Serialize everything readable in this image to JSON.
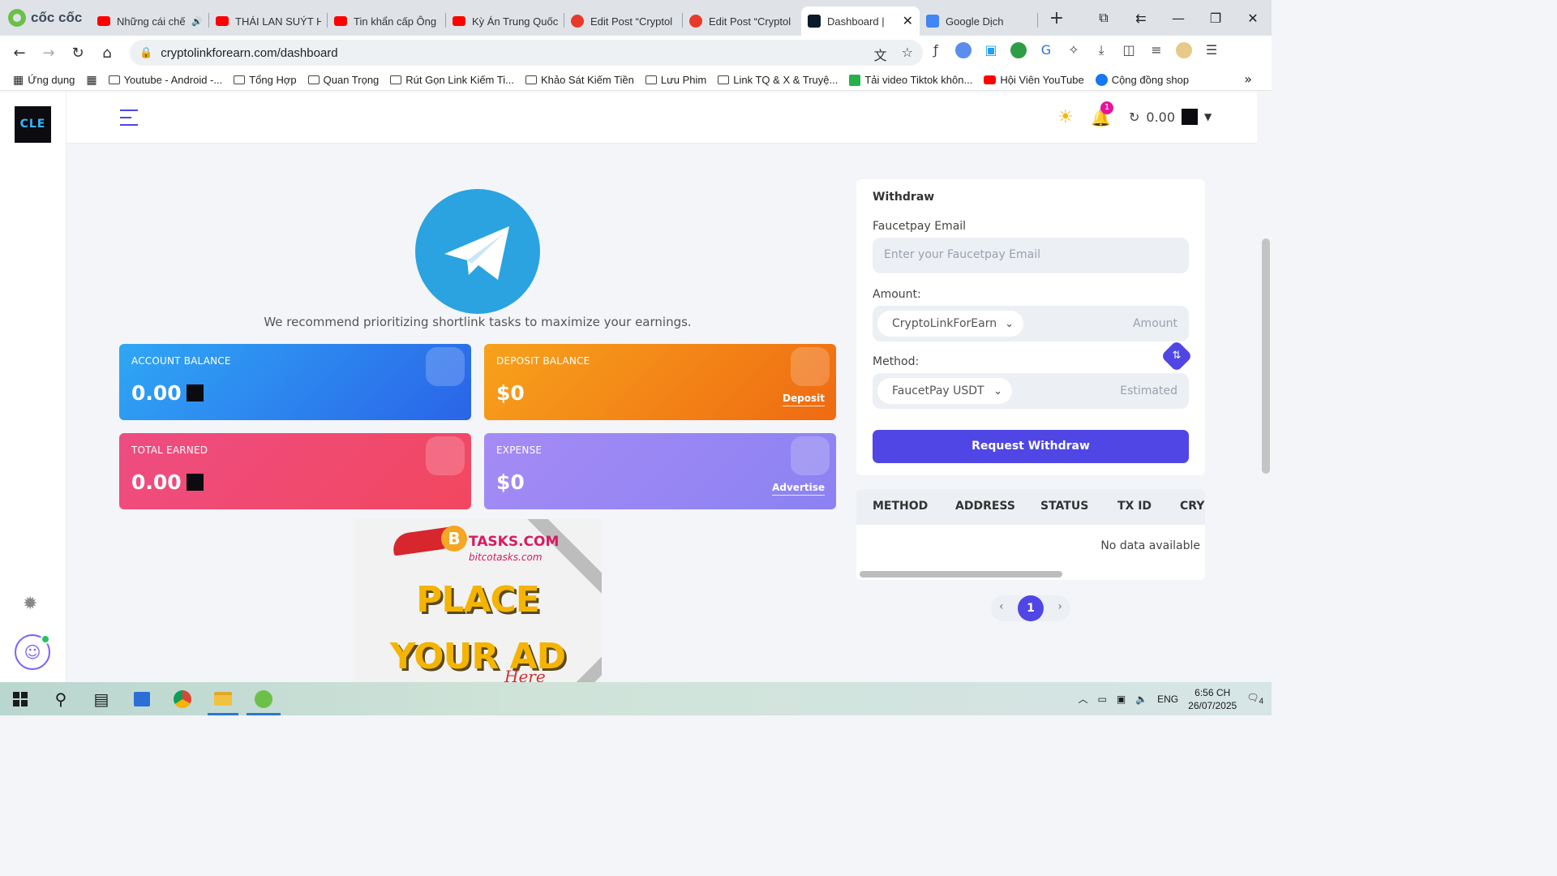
{
  "browser": {
    "brand": "cốc cốc",
    "tabs": [
      {
        "title": "Những cái chế",
        "icon": "youtube-icon"
      },
      {
        "title": "THÁI LAN SUÝT HỦ",
        "icon": "youtube-icon"
      },
      {
        "title": "Tin khẩn cấp Ông",
        "icon": "youtube-icon"
      },
      {
        "title": "Kỳ Án Trung Quốc",
        "icon": "youtube-icon"
      },
      {
        "title": "Edit Post “Cryptol",
        "icon": "edit-icon"
      },
      {
        "title": "Edit Post “Cryptol",
        "icon": "edit-icon"
      },
      {
        "title": "Dashboard |",
        "icon": "cle-icon",
        "active": true
      },
      {
        "title": "Google Dịch",
        "icon": "google-translate-icon"
      }
    ],
    "url": "cryptolinkforearn.com/dashboard",
    "bookmarks": [
      {
        "label": "Ứng dụng",
        "icon": "apps-grid-icon"
      },
      {
        "label": "",
        "icon": "apps-grid-icon"
      },
      {
        "label": "Youtube - Android -...",
        "icon": "folder-icon"
      },
      {
        "label": "Tổng Hợp",
        "icon": "folder-icon"
      },
      {
        "label": "Quan Trọng",
        "icon": "folder-icon"
      },
      {
        "label": "Rút Gọn Link Kiếm Ti...",
        "icon": "folder-icon"
      },
      {
        "label": "Khảo Sát Kiếm Tiền",
        "icon": "folder-icon"
      },
      {
        "label": "Lưu Phim",
        "icon": "folder-icon"
      },
      {
        "label": "Link TQ & X & Truyệ...",
        "icon": "folder-icon"
      },
      {
        "label": "Tải video Tiktok khôn...",
        "icon": "download-icon"
      },
      {
        "label": "Hội Viên YouTube",
        "icon": "youtube-icon"
      },
      {
        "label": "Cộng đồng shop",
        "icon": "facebook-icon"
      }
    ]
  },
  "header": {
    "logo_text": "CLE",
    "notification_count": "1",
    "balance": "0.00"
  },
  "main": {
    "recommend_text": "We recommend prioritizing shortlink tasks to maximize your earnings.",
    "cards": {
      "account_balance": {
        "label": "ACCOUNT BALANCE",
        "value": "0.00"
      },
      "deposit_balance": {
        "label": "DEPOSIT BALANCE",
        "value": "$0",
        "link": "Deposit"
      },
      "total_earned": {
        "label": "TOTAL EARNED",
        "value": "0.00"
      },
      "expense": {
        "label": "EXPENSE",
        "value": "$0",
        "link": "Advertise"
      }
    },
    "ad": {
      "brand": "TASKS.COM",
      "coin": "B",
      "domain": "bitcotasks.com",
      "line1": "PLACE",
      "line2": "YOUR AD",
      "line3": "Here"
    }
  },
  "withdraw": {
    "title": "Withdraw",
    "email_label": "Faucetpay Email",
    "email_placeholder": "Enter your Faucetpay Email",
    "amount_label": "Amount:",
    "currency_selected": "CryptoLinkForEarn",
    "amount_placeholder": "Amount",
    "method_label": "Method:",
    "method_selected": "FaucetPay USDT",
    "estimated_placeholder": "Estimated",
    "button": "Request Withdraw"
  },
  "history_table": {
    "columns": [
      "METHOD",
      "ADDRESS",
      "STATUS",
      "TX ID",
      "CRYI"
    ],
    "empty_text": "No data available",
    "current_page": "1"
  },
  "taskbar": {
    "lang": "ENG",
    "time": "6:56 CH",
    "date": "26/07/2025",
    "notifications": "4"
  },
  "colors": {
    "accent": "#4f46e5",
    "account_card": "#2a7ff0",
    "deposit_card": "#f28a16",
    "total_card": "#f04a72",
    "expense_card": "#998af4",
    "telegram": "#2aa3e0"
  }
}
